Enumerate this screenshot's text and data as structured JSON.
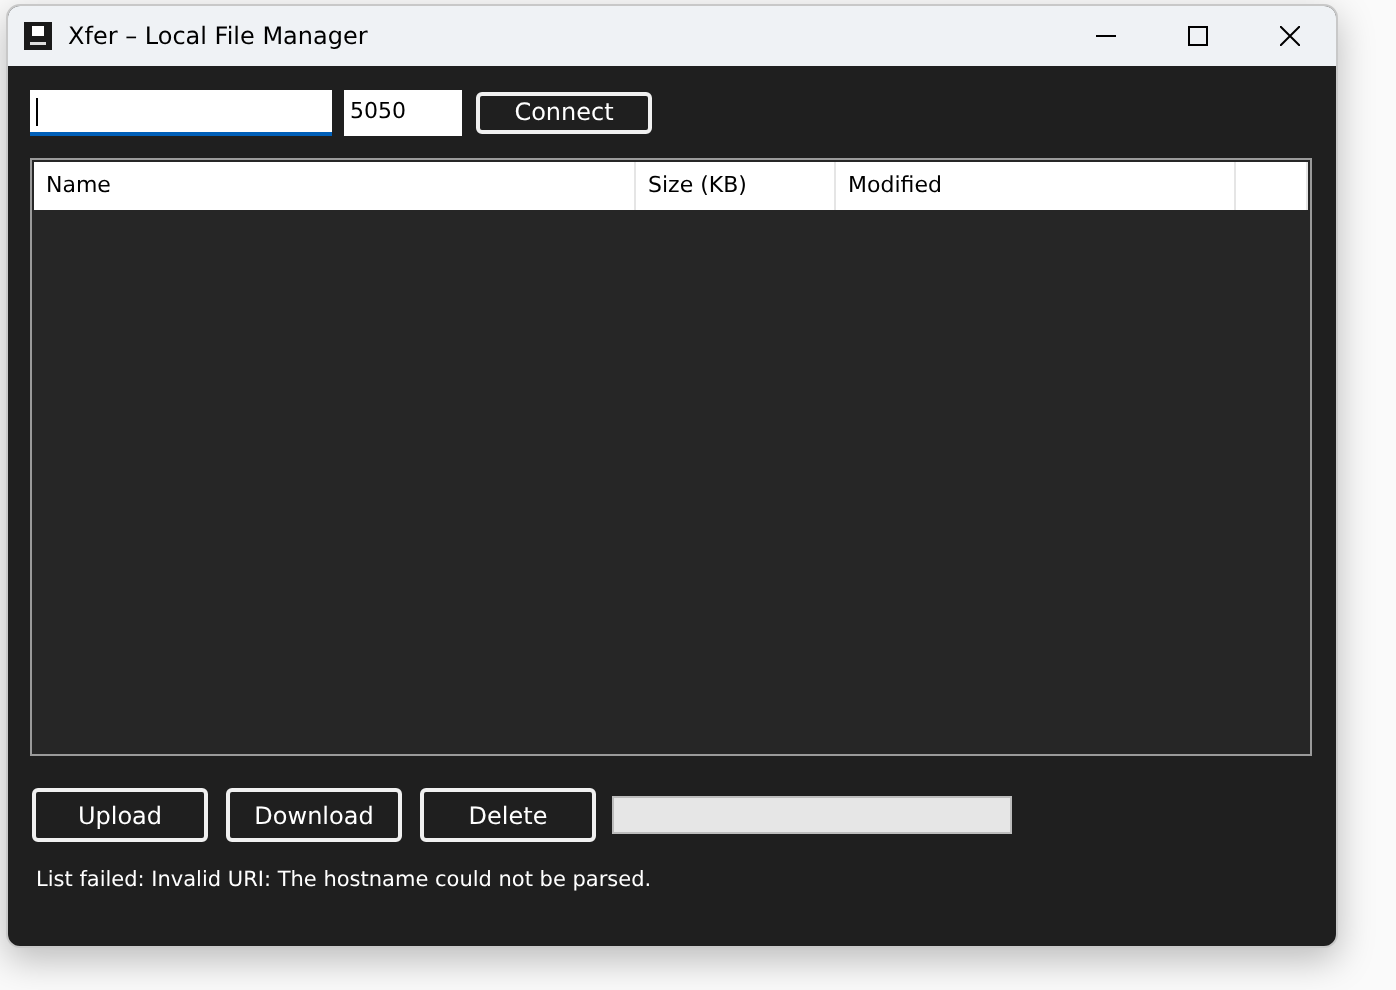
{
  "window": {
    "title": "Xfer – Local File Manager"
  },
  "connection": {
    "host": {
      "focused": true
    },
    "port": {
      "value": "5050"
    },
    "connect_button": "Connect"
  },
  "file_list": {
    "columns": [
      "Name",
      "Size (KB)",
      "Modified"
    ]
  },
  "actions": [
    "Upload",
    "Download",
    "Delete"
  ],
  "progress": {
    "level": 0
  },
  "status": "List failed: Invalid URI: The hostname could not be parsed."
}
